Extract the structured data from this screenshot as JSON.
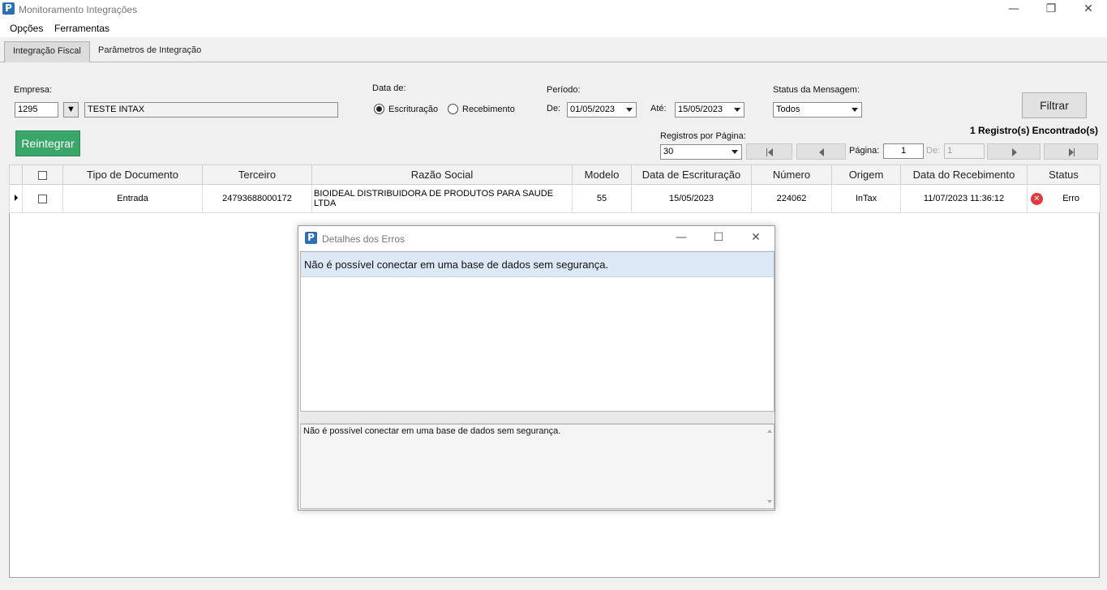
{
  "window": {
    "title": "Monitoramento Integrações",
    "icon_letter": "P",
    "minimize": "—",
    "restore": "❐",
    "close": "✕"
  },
  "menu": [
    "Opções",
    "Ferramentas"
  ],
  "tabs": [
    {
      "label": "Integração Fiscal",
      "active": true
    },
    {
      "label": "Parâmetros de Integração",
      "active": false
    }
  ],
  "filters": {
    "empresa_label": "Empresa:",
    "empresa_code": "1295",
    "empresa_name": "TESTE INTAX",
    "data_de_label": "Data de:",
    "radio_escrituracao": "Escrituração",
    "radio_recebimento": "Recebimento",
    "periodo_label": "Período:",
    "de_label": "De:",
    "de_value": "01/05/2023",
    "ate_label": "Até:",
    "ate_value": "15/05/2023",
    "status_label": "Status da Mensagem:",
    "status_value": "Todos",
    "filtrar": "Filtrar",
    "reintegrar": "Reintegrar",
    "registros_label": "Registros por Página:",
    "registros_value": "30",
    "pagina_label": "Página:",
    "pagina_value": "1",
    "de_total_label": "De:",
    "de_total_value": "1",
    "found": "1 Registro(s) Encontrado(s)"
  },
  "grid": {
    "headers": [
      "Tipo de Documento",
      "Terceiro",
      "Razão Social",
      "Modelo",
      "Data de Escrituração",
      "Número",
      "Origem",
      "Data do Recebimento",
      "Status"
    ],
    "rows": [
      {
        "tipo": "Entrada",
        "terceiro": "24793688000172",
        "razao": "BIOIDEAL DISTRIBUIDORA DE PRODUTOS PARA SAUDE LTDA",
        "modelo": "55",
        "data_escrituracao": "15/05/2023",
        "numero": "224062",
        "origem": "InTax",
        "data_recebimento": "11/07/2023 11:36:12",
        "status": "Erro"
      }
    ]
  },
  "dialog": {
    "title": "Detalhes dos Erros",
    "icon_letter": "P",
    "minimize": "—",
    "maximize": "☐",
    "close": "✕",
    "error_item": "Não é possível conectar em uma base de dados sem segurança.",
    "error_detail": "Não é possível conectar em uma base de dados sem segurança."
  },
  "colors": {
    "accent_green": "#3aa66a",
    "error_red": "#e0393e",
    "selection_blue": "#dde8f7"
  }
}
